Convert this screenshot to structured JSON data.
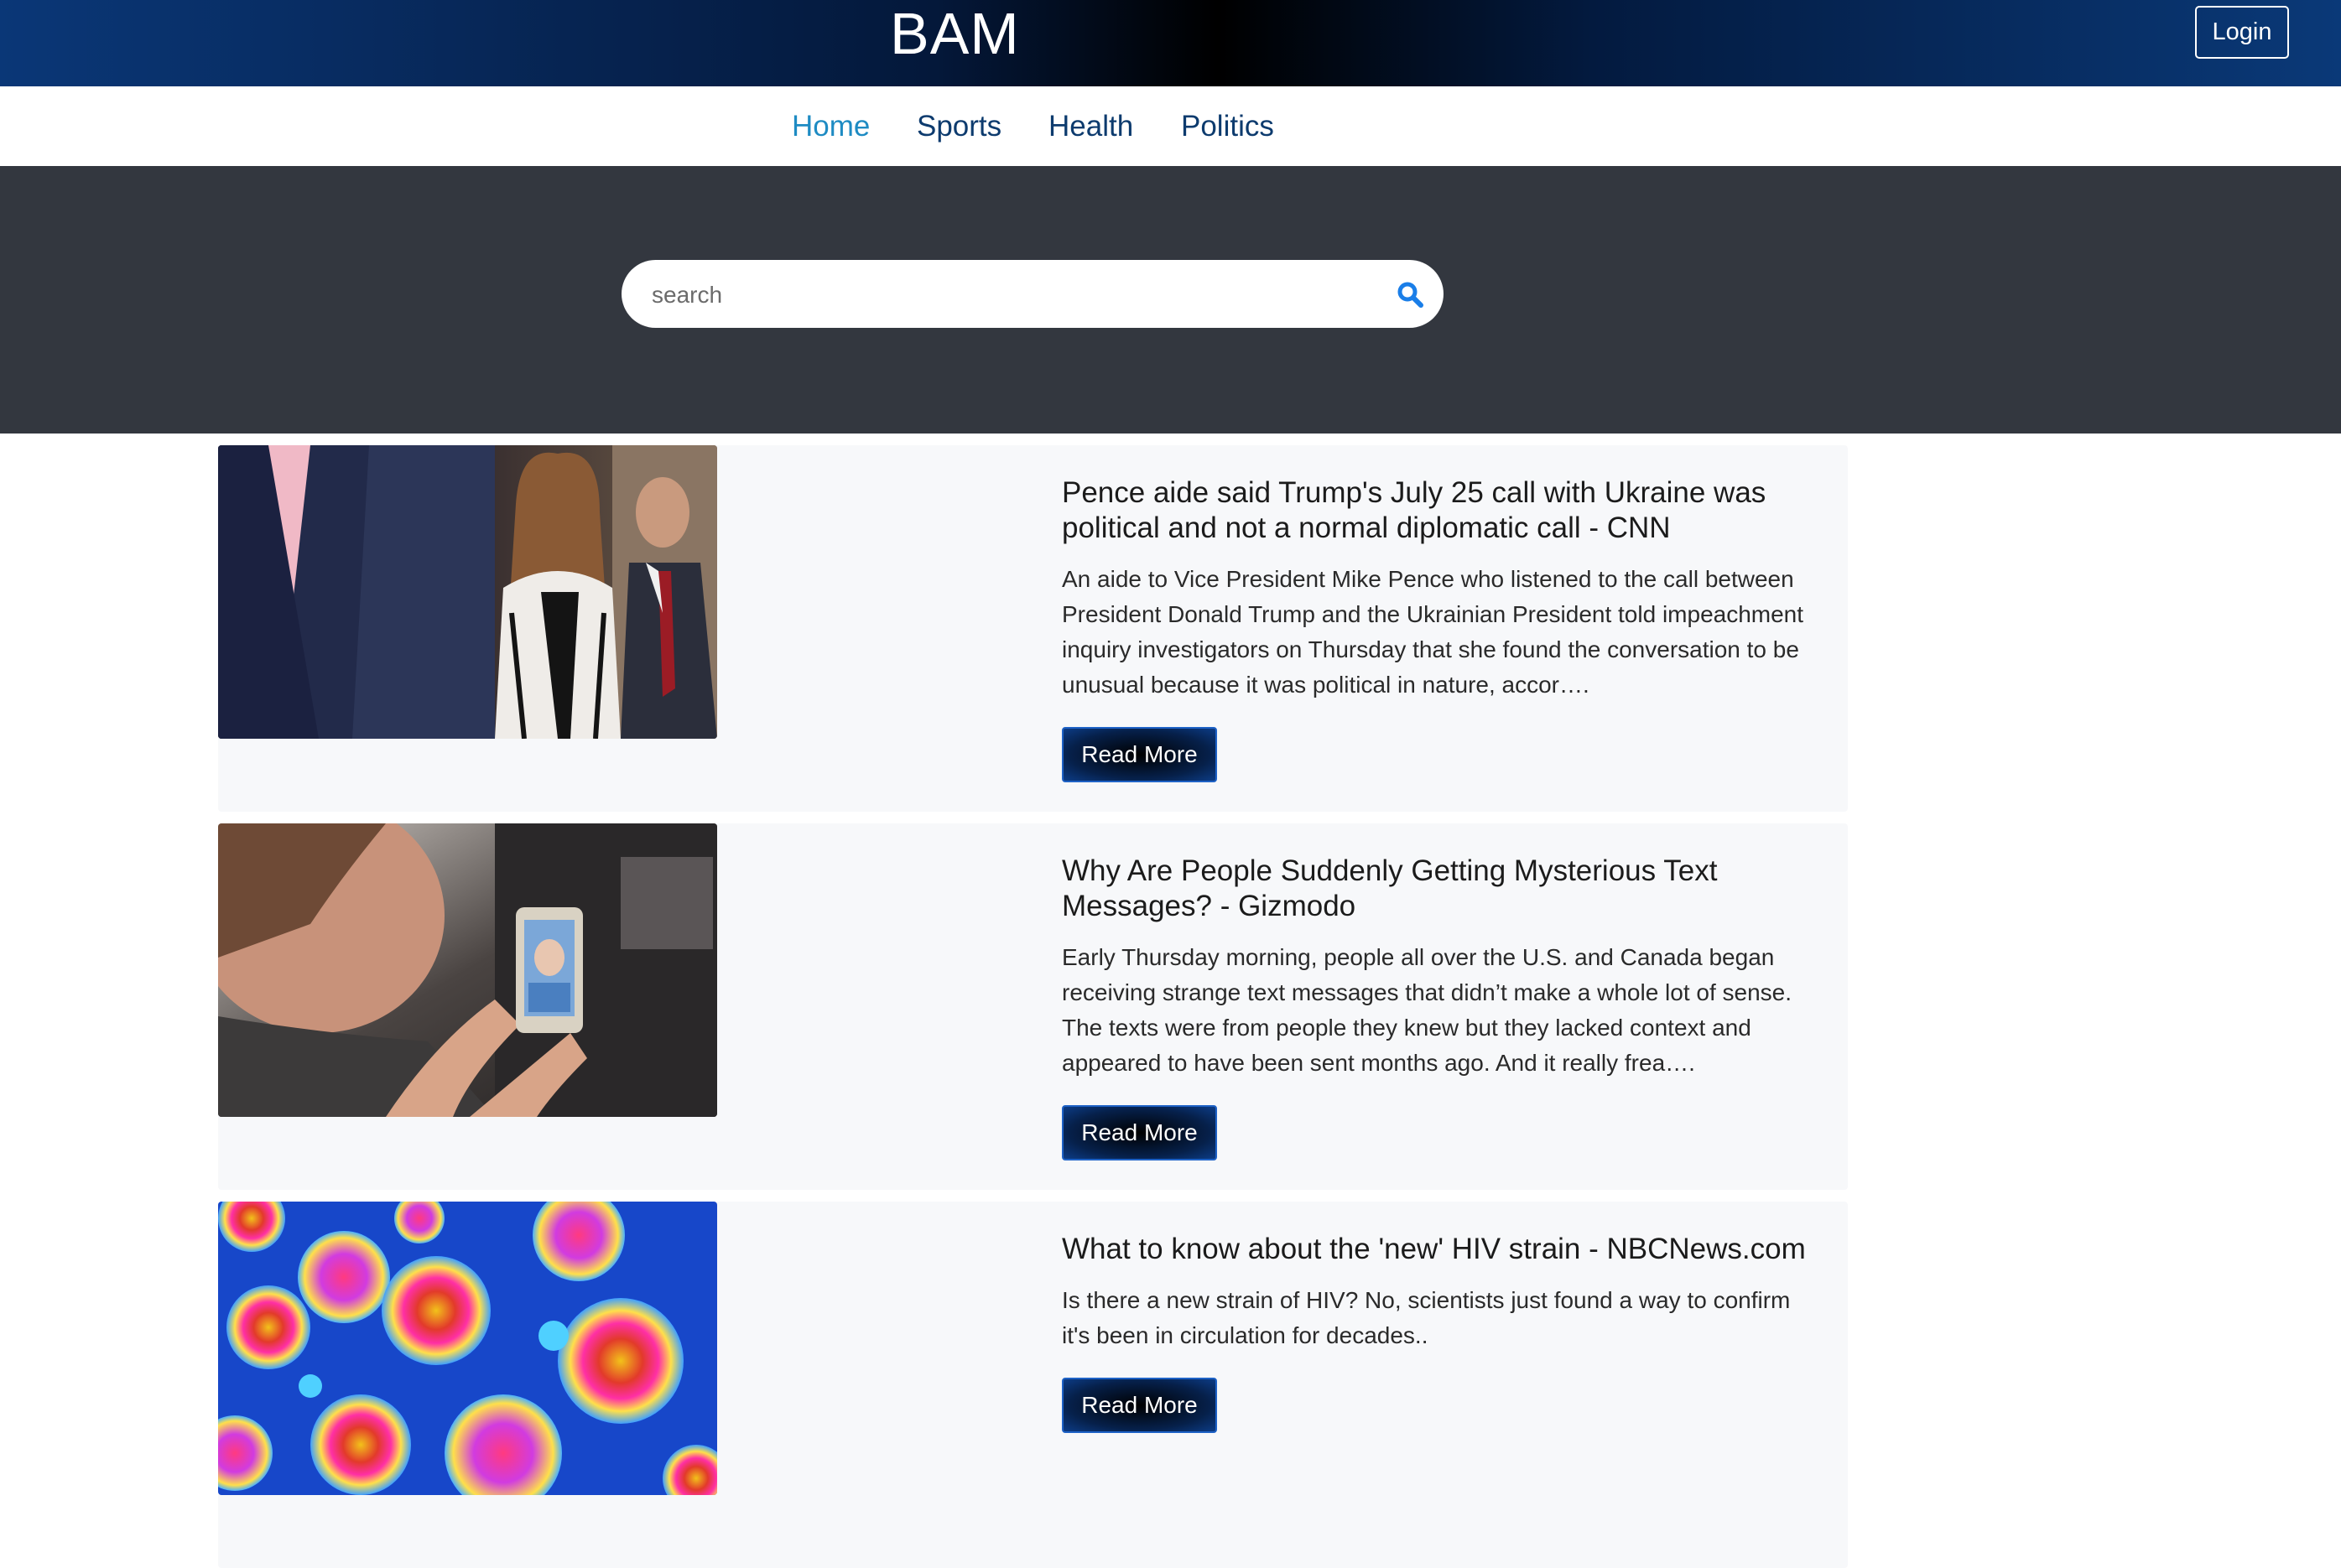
{
  "header": {
    "brand": "BAM",
    "login_label": "Login"
  },
  "nav": {
    "items": [
      {
        "label": "Home",
        "active": true
      },
      {
        "label": "Sports",
        "active": false
      },
      {
        "label": "Health",
        "active": false
      },
      {
        "label": "Politics",
        "active": false
      }
    ]
  },
  "search": {
    "placeholder": "search",
    "value": "",
    "icon": "search-icon"
  },
  "articles": [
    {
      "title": "Pence aide said Trump's July 25 call with Ukraine was political and not a normal diplomatic call - CNN",
      "description": "An aide to Vice President Mike Pence who listened to the call between President Donald Trump and the Ukrainian President told impeachment inquiry investigators on Thursday that she found the conversation to be unusual because it was political in nature, accor….",
      "button_label": "Read More"
    },
    {
      "title": "Why Are People Suddenly Getting Mysterious Text Messages? - Gizmodo",
      "description": "Early Thursday morning, people all over the U.S. and Canada began receiving strange text messages that didn’t make a whole lot of sense. The texts were from people they knew but they lacked context and appeared to have been sent months ago. And it really frea….",
      "button_label": "Read More"
    },
    {
      "title": "What to know about the 'new' HIV strain - NBCNews.com",
      "description": "Is there a new strain of HIV? No, scientists just found a way to confirm it's been in circulation for decades..",
      "button_label": "Read More"
    }
  ],
  "colors": {
    "header_gradient_edge": "#0a3777",
    "header_gradient_center": "#000000",
    "nav_link": "#0d3b6e",
    "nav_active": "#1e8bc3",
    "hero_bg": "#33373f",
    "card_bg": "#f7f8fa",
    "button_border": "#1e62c6",
    "search_icon": "#1a7ee8"
  }
}
